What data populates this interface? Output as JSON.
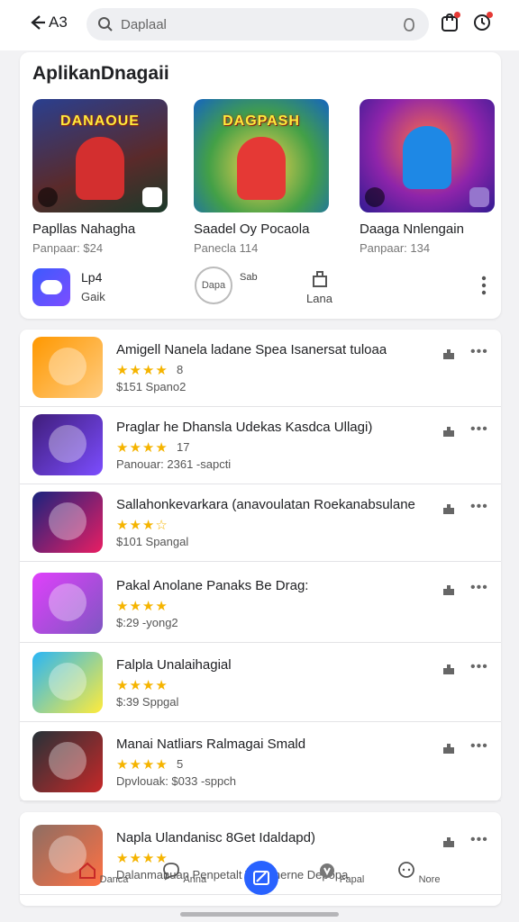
{
  "topbar": {
    "back_label": "A3",
    "search_placeholder": "Daplaal"
  },
  "featured": {
    "title": "AplikanDnagaii",
    "items": [
      {
        "name": "Papllas Nahagha",
        "price": "Panpaar: $24",
        "art_text": "DANAOUE",
        "bg": "#3b2a6e"
      },
      {
        "name": "Saadel Oy Pocaola",
        "price": "Panecla 114",
        "art_text": "DAGPASH",
        "bg": "#ff8f00"
      },
      {
        "name": "Daaga Nnlengain",
        "price": "Panpaar: 134",
        "art_text": "",
        "bg": "#6a1b9a"
      }
    ],
    "mini": {
      "app_label_1": "Lp4",
      "app_label_2": "Gaik",
      "circle_label": "Dapa",
      "circle_side": "Sab",
      "share_label": "Lana"
    }
  },
  "list": [
    {
      "title": "Amigell Nanela ladane Spea Isanersat tuloaa",
      "stars": "★★★★",
      "count": "8",
      "meta": "$151  Spano2",
      "colors": [
        "#ff9800",
        "#ffcc80"
      ]
    },
    {
      "title": "Praglar he Dhansla Udekas Kasdca Ullagi)",
      "stars": "★★★★",
      "count": "17",
      "meta": "Panouar: 2361  -sapcti",
      "colors": [
        "#3f1d7a",
        "#7c4dff"
      ]
    },
    {
      "title": "Sallahonkevarkara (anavoulatan Roekanabsulane",
      "stars": "★★★☆",
      "count": "",
      "meta": "$101  Spangal",
      "colors": [
        "#1a237e",
        "#e91e63"
      ]
    },
    {
      "title": "Pakal Anolane Panaks Be Drag:",
      "stars": "★★★★",
      "count": "",
      "meta": "$:29  -yong2",
      "colors": [
        "#e040fb",
        "#7e57c2"
      ]
    },
    {
      "title": "Falpla Unalaihagial",
      "stars": "★★★★",
      "count": "",
      "meta": "$:39  Sppgal",
      "colors": [
        "#29b6f6",
        "#ffeb3b"
      ]
    },
    {
      "title": "Manai Natliars Ralmagai Smald",
      "stars": "★★★★",
      "count": "5",
      "meta": "Dpvlouak: $033  -sppch",
      "colors": [
        "#263238",
        "#c62828"
      ]
    },
    {
      "title": "Napla Ulandanisc 8Get Idaldapd)",
      "stars": "★★★★",
      "count": "",
      "meta": "Dalanmanuan  Penpetalt  Tipennerne  Depopa",
      "colors": [
        "#8d6e63",
        "#ff7043"
      ]
    }
  ],
  "nav": [
    {
      "label": "Danca",
      "icon": "home-icon"
    },
    {
      "label": "Anna",
      "icon": "chat-icon"
    },
    {
      "label": "",
      "icon": "edit-icon"
    },
    {
      "label": "Fapal",
      "icon": "shield-icon"
    },
    {
      "label": "Nore",
      "icon": "message-icon"
    }
  ],
  "accent": "#2962ff",
  "star_color": "#f5b400"
}
